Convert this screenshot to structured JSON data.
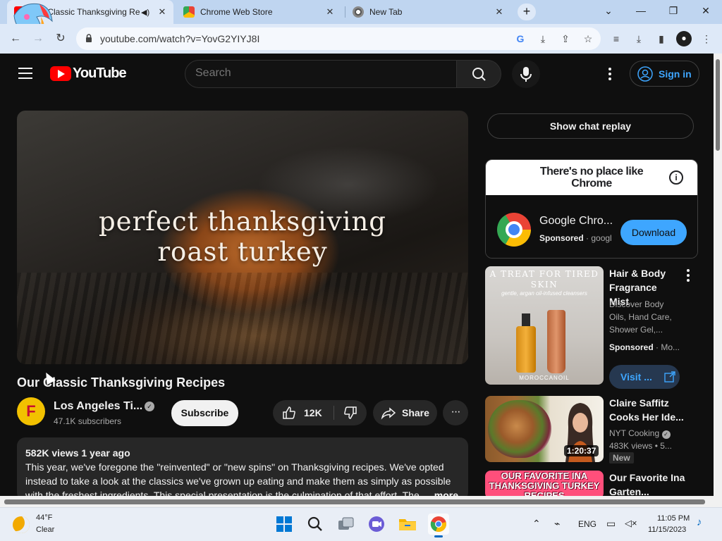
{
  "browser": {
    "tabs": [
      {
        "title": "Our Classic Thanksgiving Re",
        "close": "✕"
      },
      {
        "title": "Chrome Web Store",
        "close": "✕"
      },
      {
        "title": "New Tab",
        "close": "✕"
      }
    ],
    "new_tab": "+",
    "window_controls": {
      "dropdown": "⌄",
      "minimize": "—",
      "restore": "❐",
      "close": "✕"
    },
    "url": "youtube.com/watch?v=YovG2YIYJ8I",
    "nav": {
      "back": "←",
      "forward": "→",
      "reload": "↻"
    }
  },
  "youtube": {
    "logo_text": "YouTube",
    "search_placeholder": "Search",
    "sign_in": "Sign in",
    "video_overlay_title": "perfect thanksgiving\nroast turkey",
    "video_title": "Our Classic Thanksgiving Recipes",
    "channel": {
      "name": "Los Angeles Ti...",
      "subscribers": "47.1K subscribers",
      "avatar_letter": "F"
    },
    "subscribe": "Subscribe",
    "likes": "12K",
    "share": "Share",
    "more": "···",
    "description": {
      "meta": "582K views  1 year ago",
      "text": "This year, we've foregone the \"reinvented\" or \"new spins\" on Thanksgiving recipes. We've opted instead to take a look at the classics we've grown up eating and make them as simply as possible with the freshest ingredients. This special presentation is the culmination of that effort. The",
      "more_label": "...more"
    },
    "sidebar": {
      "chat_replay": "Show chat replay",
      "ad": {
        "banner": "There's no place like Chrome",
        "app_name": "Google Chro...",
        "sponsored": "Sponsored",
        "advertiser": "googl",
        "download": "Download"
      },
      "recommendations": [
        {
          "title": "Hair & Body Fragrance Mist",
          "description": "Discover Body Oils, Hand Care, Shower Gel,...",
          "sponsored": "Sponsored",
          "advertiser": "Mo...",
          "visit": "Visit ...",
          "thumb_headline": "A TREAT FOR TIRED SKIN",
          "thumb_sub": "gentle, argan oil-infused cleansers",
          "thumb_brand": "MOROCCANOIL"
        },
        {
          "title": "Claire Saffitz Cooks Her Ide...",
          "channel": "NYT Cooking",
          "stats": "483K views  • 5...",
          "duration": "1:20:37",
          "badge": "New"
        },
        {
          "title": "Our Favorite Ina Garten...",
          "thumb_text": "OUR FAVORITE INA THANKSGIVING TURKEY RECIPES"
        }
      ]
    }
  },
  "taskbar": {
    "weather": {
      "temp": "44°F",
      "condition": "Clear"
    },
    "language": "ENG",
    "time": "11:05 PM",
    "date": "11/15/2023"
  },
  "colors": {
    "youtube_red": "#ff0000",
    "link_blue": "#3ea6ff",
    "chrome_frame": "#dee9f8"
  }
}
